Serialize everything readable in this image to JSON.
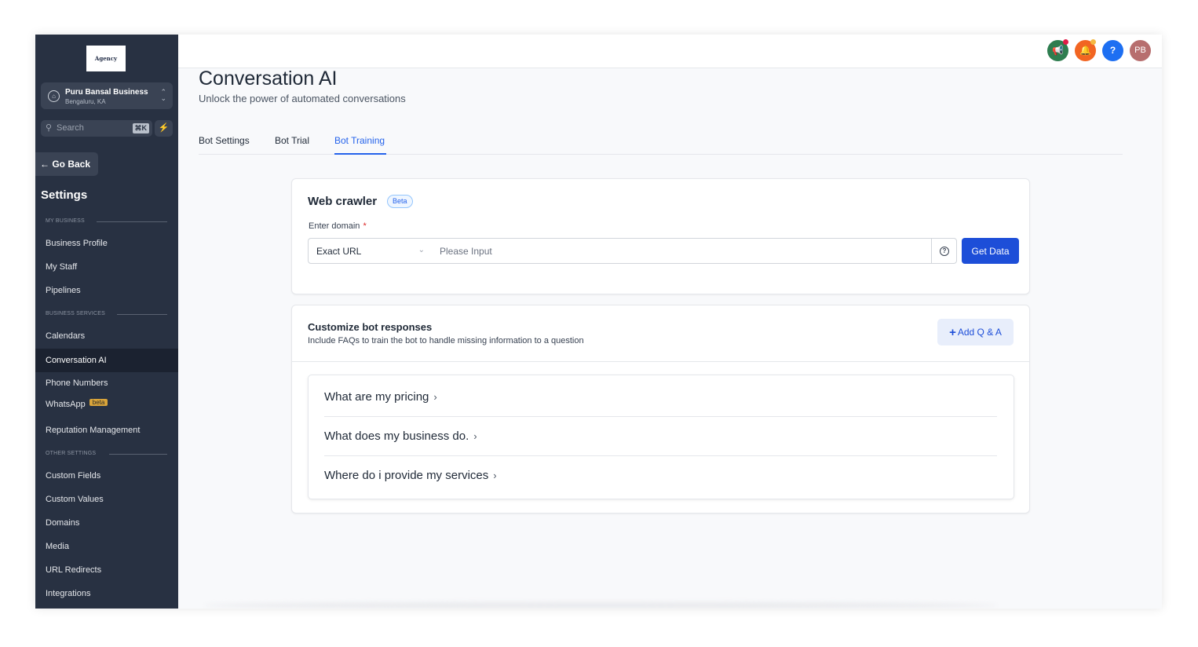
{
  "sidebar": {
    "logo_text": "Agency",
    "account": {
      "name": "Puru Bansal Business",
      "location": "Bengaluru, KA"
    },
    "search": {
      "placeholder": "Search",
      "shortcut": "⌘K"
    },
    "go_back": "Go Back",
    "heading": "Settings",
    "sections": {
      "my_business": "MY BUSINESS",
      "business_services": "BUSINESS SERVICES",
      "other_settings": "OTHER SETTINGS"
    },
    "items": {
      "business_profile": "Business Profile",
      "my_staff": "My Staff",
      "pipelines": "Pipelines",
      "calendars": "Calendars",
      "conversation_ai": "Conversation AI",
      "phone_numbers": "Phone Numbers",
      "whatsapp": "WhatsApp",
      "whatsapp_badge": "beta",
      "reputation": "Reputation Management",
      "custom_fields": "Custom Fields",
      "custom_values": "Custom Values",
      "domains": "Domains",
      "media": "Media",
      "url_redirects": "URL Redirects",
      "integrations": "Integrations"
    }
  },
  "topbar": {
    "icons": [
      "megaphone-icon",
      "bell-icon",
      "help-icon"
    ],
    "avatar_initials": "PB",
    "colors": {
      "megaphone": "#2e7d4f",
      "bell": "#f26522",
      "help": "#1d6ff2",
      "avatar": "#b76e6e",
      "notif_dot": "#e11d48"
    }
  },
  "main": {
    "title": "Conversation AI",
    "subtitle": "Unlock the power of automated conversations",
    "tabs": [
      "Bot Settings",
      "Bot Trial",
      "Bot Training"
    ],
    "active_tab": "Bot Training"
  },
  "web_crawler": {
    "title": "Web crawler",
    "badge": "Beta",
    "label": "Enter domain",
    "required_mark": "*",
    "select_value": "Exact URL",
    "input_placeholder": "Please Input",
    "button": "Get Data"
  },
  "customize": {
    "title": "Customize bot responses",
    "subtitle": "Include FAQs to train the bot to handle missing information to a question",
    "add_button": "Add Q & A",
    "faqs": [
      "What are my pricing",
      "What does my business do.",
      "Where do i provide my services"
    ]
  },
  "colors": {
    "accent": "#1d4ed8",
    "sidebar_bg": "#283142"
  }
}
